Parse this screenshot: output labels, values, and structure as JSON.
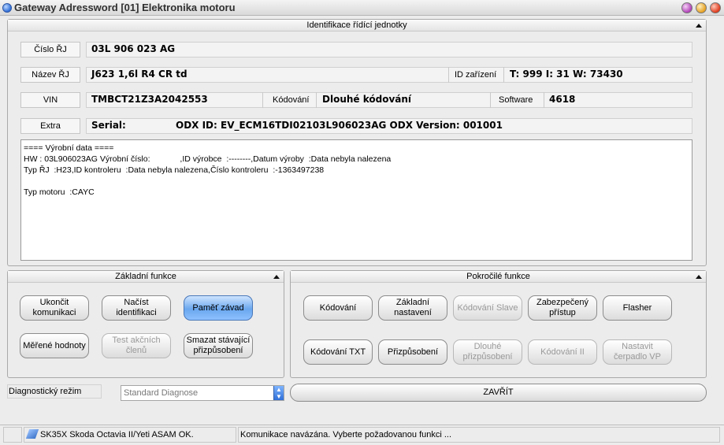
{
  "window": {
    "title": "Gateway Adressword [01] Elektronika motoru"
  },
  "identification": {
    "header": "Identifikace řídící jednotky",
    "cislo_label": "Číslo ŘJ",
    "cislo_value": "03L 906 023 AG",
    "nazev_label": "Název ŘJ",
    "nazev_value": "J623  1,6l R4 CR td",
    "id_label": "ID zařízení",
    "id_value": "T: 999 I: 31 W: 73430",
    "vin_label": "VIN",
    "vin_value": "TMBCT21Z3A2042553",
    "kodovani_label": "Kódování",
    "kodovani_value": "Dlouhé kódování",
    "software_label": "Software",
    "software_value": "4618",
    "extra_label": "Extra",
    "extra_value_serial": "Serial:",
    "extra_value_odx": "ODX ID: EV_ECM16TDI02103L906023AG ODX Version: 001001"
  },
  "production_data": {
    "lines": [
      "==== Výrobní data ====",
      "HW : 03L906023AG Výrobní číslo:             ,ID výrobce  :--------,Datum výroby  :Data nebyla nalezena",
      "Typ ŘJ  :H23,ID kontroleru  :Data nebyla nalezena,Číslo kontroleru  :-1363497238",
      "",
      "Typ motoru  :CAYC"
    ]
  },
  "basic_functions": {
    "header": "Základní funkce",
    "buttons": [
      {
        "label": "Ukončit komunikaci",
        "state": "normal"
      },
      {
        "label": "Načíst identifikaci",
        "state": "normal"
      },
      {
        "label": "Paměť závad",
        "state": "active"
      },
      {
        "label": "Měřené hodnoty",
        "state": "normal"
      },
      {
        "label": "Test akčních členů",
        "state": "disabled"
      },
      {
        "label": "Smazat stávající přizpůsobení",
        "state": "normal"
      }
    ]
  },
  "advanced_functions": {
    "header": "Pokročilé funkce",
    "buttons": [
      {
        "label": "Kódování",
        "state": "normal"
      },
      {
        "label": "Základní nastavení",
        "state": "normal"
      },
      {
        "label": "Kódování Slave",
        "state": "disabled"
      },
      {
        "label": "Zabezpečený přístup",
        "state": "normal"
      },
      {
        "label": "Flasher",
        "state": "normal"
      },
      {
        "label": "Kódování TXT",
        "state": "normal"
      },
      {
        "label": "Přizpůsobení",
        "state": "normal"
      },
      {
        "label": "Dlouhé přizpůsobení",
        "state": "disabled"
      },
      {
        "label": "Kódování II",
        "state": "disabled"
      },
      {
        "label": "Nastavit čerpadlo VP",
        "state": "disabled"
      }
    ]
  },
  "diagnostics": {
    "mode_label": "Diagnostický režim",
    "mode_value": "Standard Diagnose",
    "close_label": "ZAVŘÍT"
  },
  "status": {
    "interface": "SK35X Skoda Octavia II/Yeti ASAM OK.",
    "message": "Komunikace navázána. Vyberte požadovanou funkci ..."
  },
  "colors": {
    "accent": "#6aa7ee",
    "disabled_text": "#999999"
  }
}
